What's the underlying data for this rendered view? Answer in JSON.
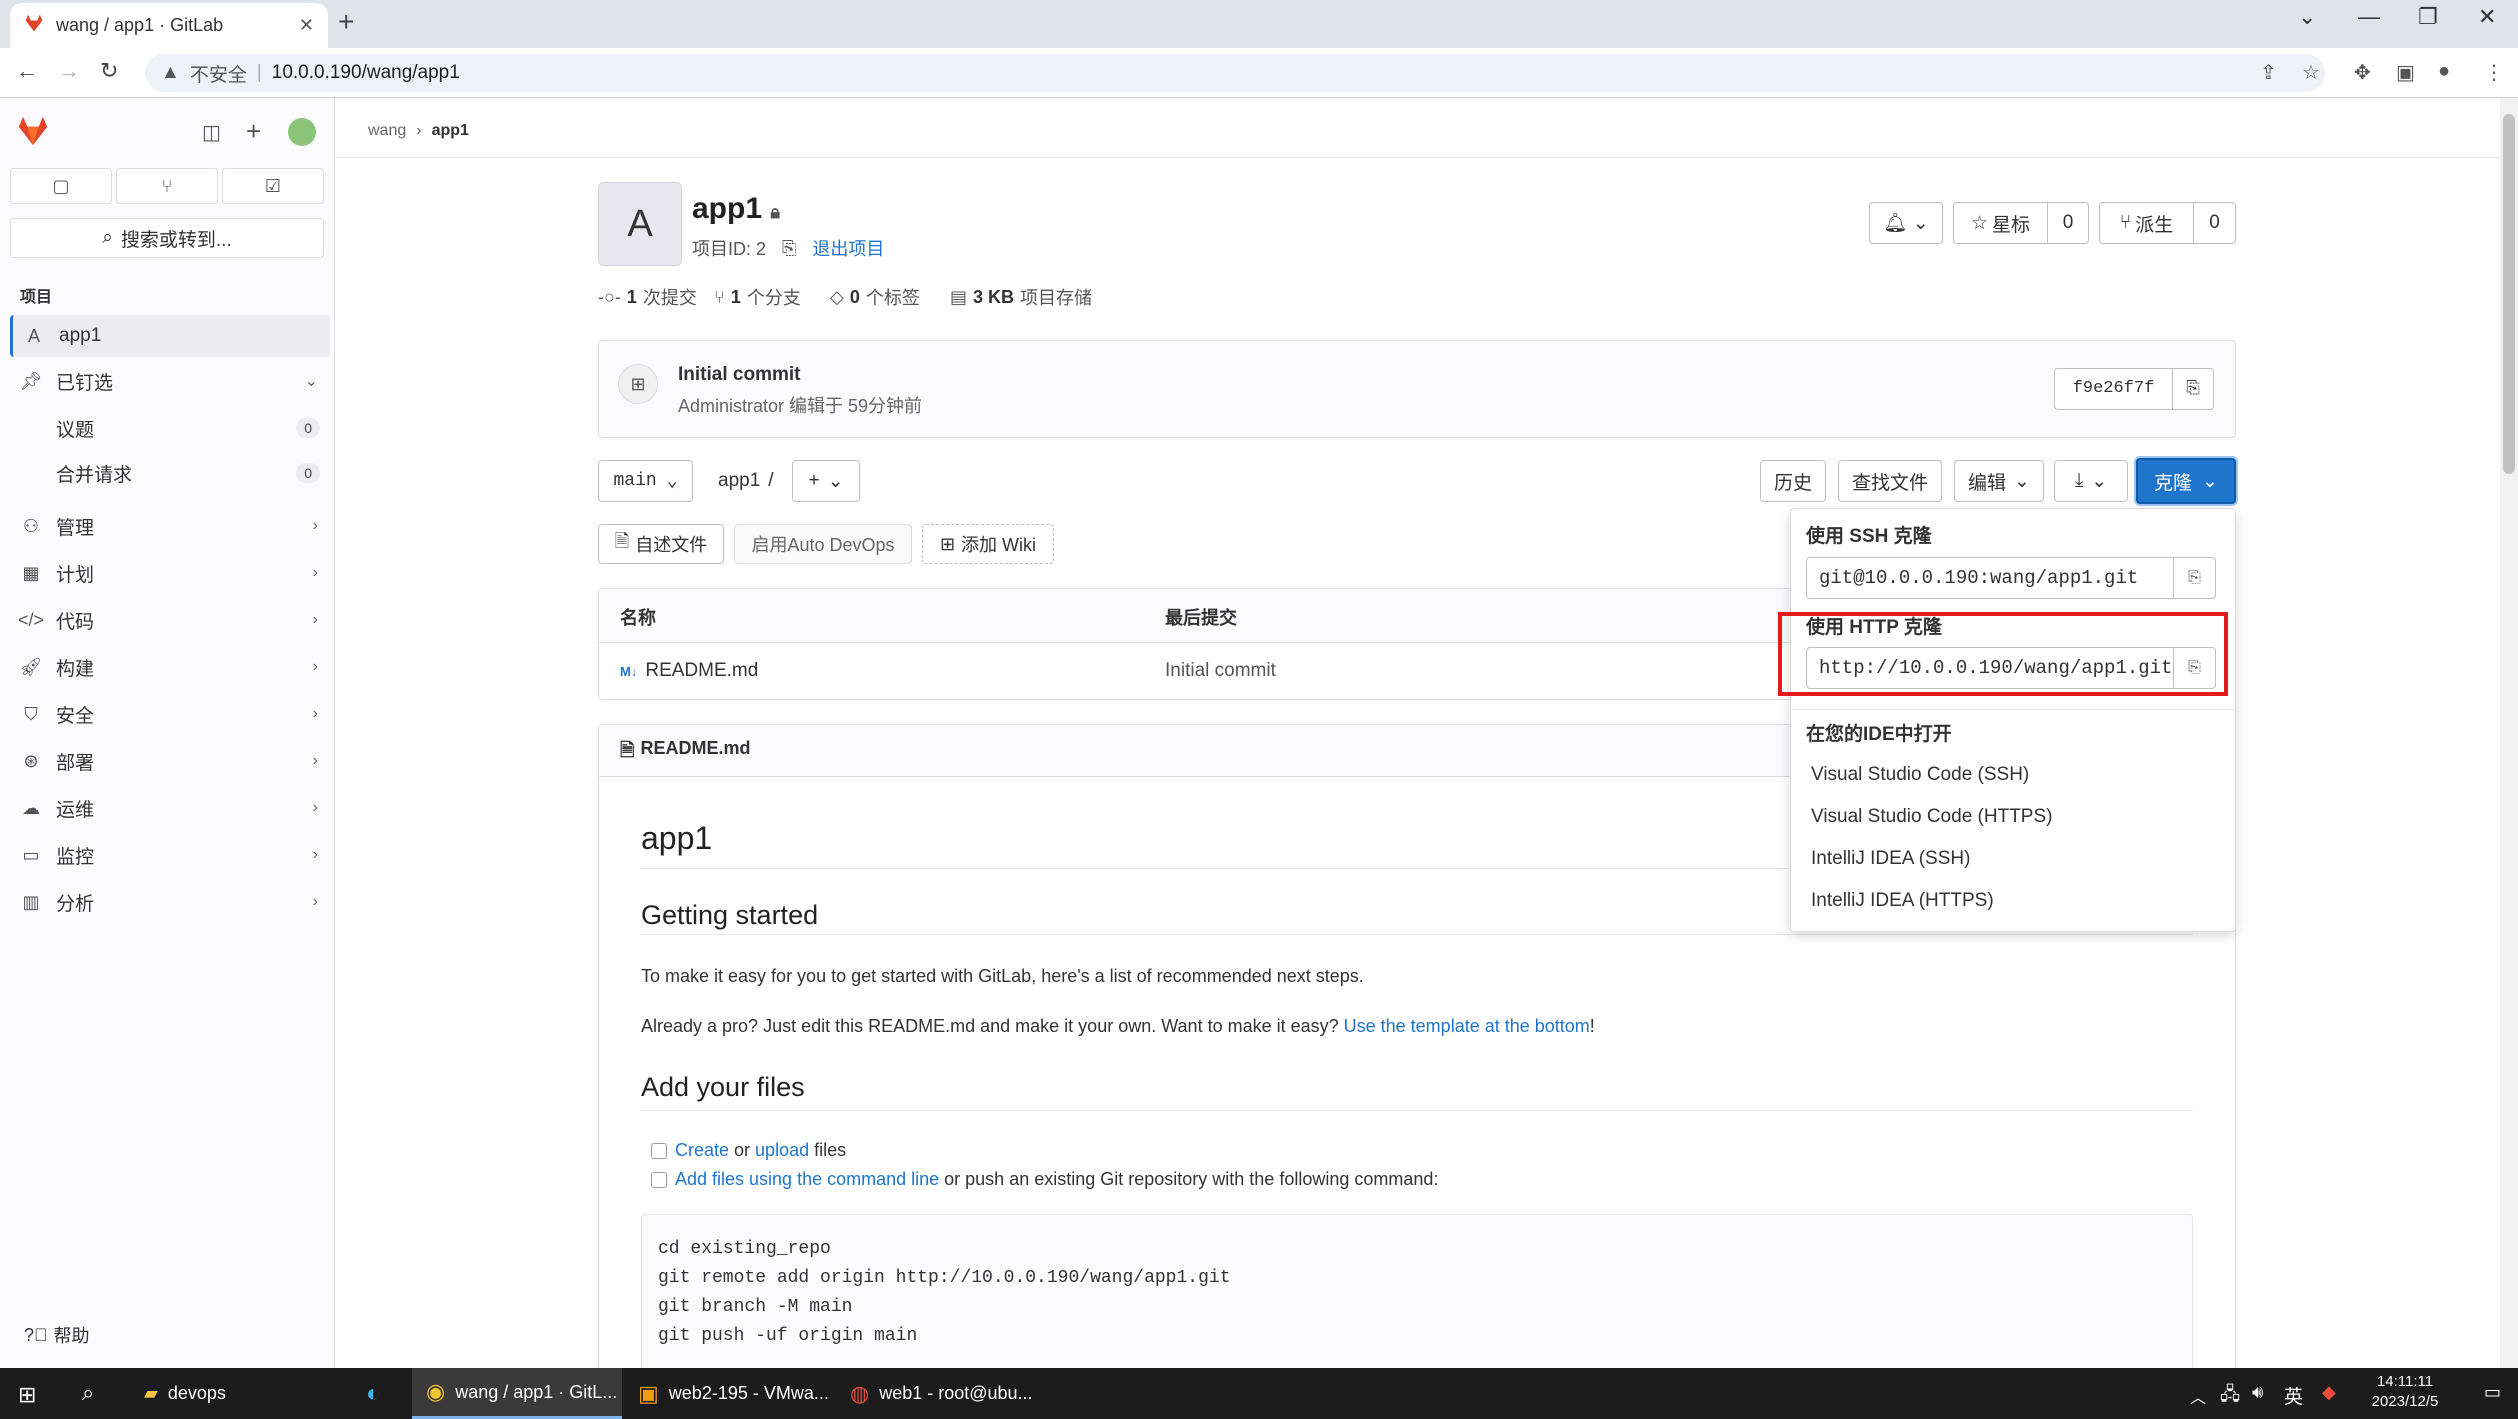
{
  "browser": {
    "tab_title": "wang / app1 · GitLab",
    "insecure_label": "不安全",
    "url": "10.0.0.190/wang/app1"
  },
  "sidebar": {
    "search_label": "搜索或转到...",
    "section_label": "项目",
    "project_item": {
      "avatar_letter": "A",
      "label": "app1"
    },
    "pinned_label": "已钉选",
    "pinned_items": [
      {
        "label": "议题",
        "count": "0"
      },
      {
        "label": "合并请求",
        "count": "0"
      }
    ],
    "groups": [
      {
        "label": "管理",
        "icon": "users-icon"
      },
      {
        "label": "计划",
        "icon": "calendar-icon"
      },
      {
        "label": "代码",
        "icon": "code-icon"
      },
      {
        "label": "构建",
        "icon": "rocket-icon"
      },
      {
        "label": "安全",
        "icon": "shield-icon"
      },
      {
        "label": "部署",
        "icon": "deploy-icon"
      },
      {
        "label": "运维",
        "icon": "monitor-cloud-icon"
      },
      {
        "label": "监控",
        "icon": "monitor-icon"
      },
      {
        "label": "分析",
        "icon": "chart-icon"
      }
    ],
    "help_label": "帮助"
  },
  "breadcrumb": {
    "parent": "wang",
    "current": "app1"
  },
  "project": {
    "avatar_letter": "A",
    "name": "app1",
    "id_label": "项目ID: 2",
    "leave_label": "退出项目",
    "star_label": "星标",
    "star_count": "0",
    "fork_label": "派生",
    "fork_count": "0",
    "stats": {
      "commits_num": "1",
      "commits_label": "次提交",
      "branches_num": "1",
      "branches_label": "个分支",
      "tags_num": "0",
      "tags_label": "个标签",
      "storage_num": "3 KB",
      "storage_label": "项目存储"
    }
  },
  "last_commit": {
    "title": "Initial commit",
    "meta": "Administrator 编辑于 59分钟前",
    "sha": "f9e26f7f"
  },
  "repo_toolbar": {
    "branch": "main",
    "path": "app1",
    "path_sep": "/",
    "history": "历史",
    "find_file": "查找文件",
    "edit": "编辑",
    "clone": "克隆"
  },
  "quick_actions": {
    "readme": "自述文件",
    "autodevops": "启用Auto DevOps",
    "wiki": "添加 Wiki"
  },
  "file_table": {
    "headers": [
      "名称",
      "最后提交"
    ],
    "rows": [
      {
        "name": "README.md",
        "commit": "Initial commit"
      }
    ]
  },
  "readme": {
    "header": "README.md",
    "h1": "app1",
    "h2_getting_started": "Getting started",
    "p1": "To make it easy for you to get started with GitLab, here's a list of recommended next steps.",
    "p2_prefix": "Already a pro? Just edit this README.md and make it your own. Want to make it easy? ",
    "p2_link": "Use the template at the bottom",
    "p2_suffix": "!",
    "h2_add_files": "Add your files",
    "task1_link1": "Create",
    "task1_mid": " or ",
    "task1_link2": "upload",
    "task1_suffix": " files",
    "task2_link": "Add files using the command line",
    "task2_suffix": " or push an existing Git repository with the following command:",
    "code_lines": [
      "cd existing_repo",
      "git remote add origin http://10.0.0.190/wang/app1.git",
      "git branch -M main",
      "git push -uf origin main"
    ]
  },
  "clone_dropdown": {
    "ssh_label": "使用 SSH 克隆",
    "ssh_url": "git@10.0.0.190:wang/app1.git",
    "http_label": "使用 HTTP 克隆",
    "http_url": "http://10.0.0.190/wang/app1.git",
    "ide_label": "在您的IDE中打开",
    "ide_options": [
      "Visual Studio Code (SSH)",
      "Visual Studio Code (HTTPS)",
      "IntelliJ IDEA (SSH)",
      "IntelliJ IDEA (HTTPS)"
    ]
  },
  "taskbar": {
    "apps": [
      {
        "label": "devops"
      },
      {
        "label": "wang / app1 · GitL..."
      },
      {
        "label": "web2-195 - VMwa..."
      },
      {
        "label": "web1 - root@ubu..."
      }
    ],
    "ime": "英",
    "time": "14:11:11",
    "date": "2023/12/5"
  },
  "colors": {
    "accent": "#1f75cb",
    "highlight_box": "#e31b1b",
    "sidebar_bg": "#fbfafd"
  }
}
